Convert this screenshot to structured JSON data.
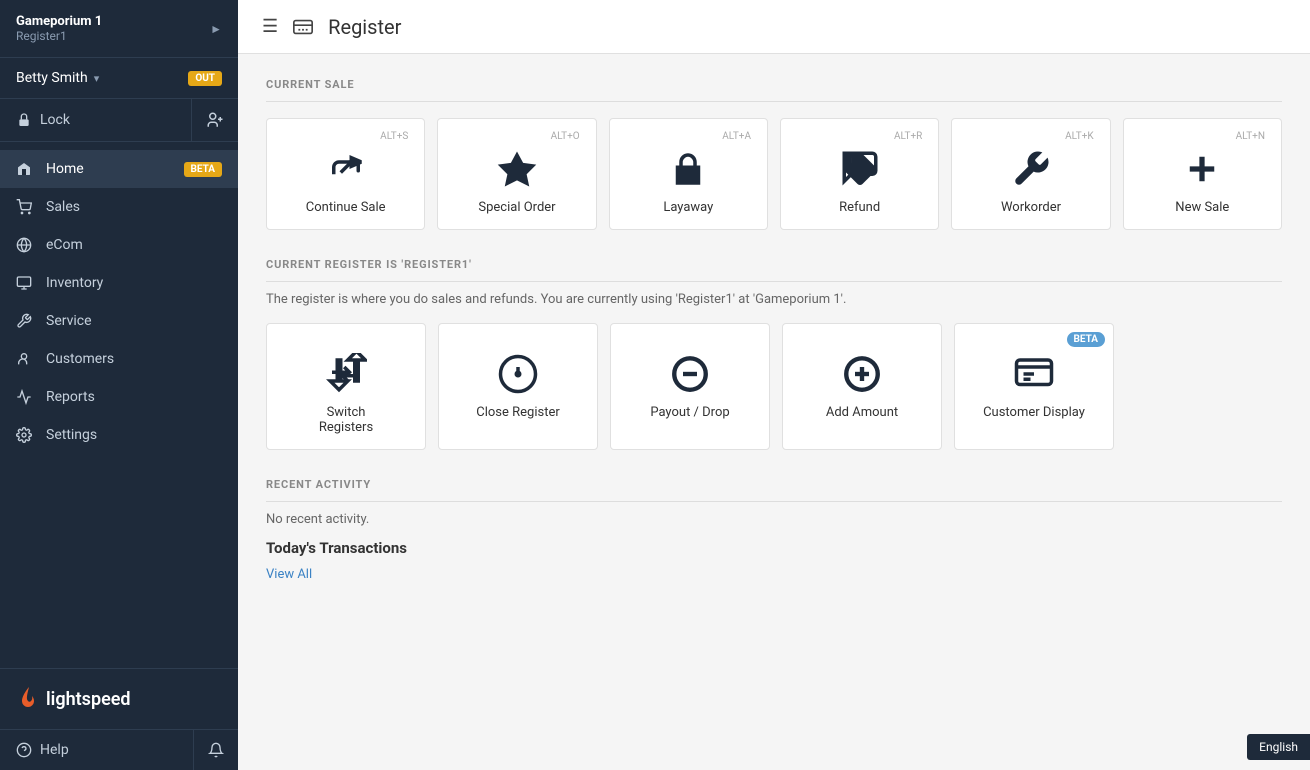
{
  "sidebar": {
    "store_name": "Gameporium 1",
    "register_name": "Register1",
    "user_name": "Betty Smith",
    "user_status_badge": "OUT",
    "lock_label": "Lock",
    "add_user_icon": "➕",
    "nav_items": [
      {
        "id": "home",
        "label": "Home",
        "badge": "BETA"
      },
      {
        "id": "sales",
        "label": "Sales",
        "badge": null
      },
      {
        "id": "ecom",
        "label": "eCom",
        "badge": null
      },
      {
        "id": "inventory",
        "label": "Inventory",
        "badge": null
      },
      {
        "id": "service",
        "label": "Service",
        "badge": null
      },
      {
        "id": "customers",
        "label": "Customers",
        "badge": null
      },
      {
        "id": "reports",
        "label": "Reports",
        "badge": null
      },
      {
        "id": "settings",
        "label": "Settings",
        "badge": null
      }
    ],
    "logo_text": "lightspeed",
    "help_label": "Help"
  },
  "topbar": {
    "title": "Register"
  },
  "current_sale": {
    "section_title": "CURRENT SALE",
    "cards": [
      {
        "id": "continue-sale",
        "shortcut": "ALT+S",
        "label": "Continue Sale"
      },
      {
        "id": "special-order",
        "shortcut": "ALT+O",
        "label": "Special Order"
      },
      {
        "id": "layaway",
        "shortcut": "ALT+A",
        "label": "Layaway"
      },
      {
        "id": "refund",
        "shortcut": "ALT+R",
        "label": "Refund"
      },
      {
        "id": "workorder",
        "shortcut": "ALT+K",
        "label": "Workorder"
      },
      {
        "id": "new-sale",
        "shortcut": "ALT+N",
        "label": "New Sale"
      }
    ]
  },
  "current_register": {
    "section_title": "CURRENT REGISTER IS 'REGISTER1'",
    "info_text": "The register is where you do sales and refunds. You are currently using 'Register1'  at 'Gameporium 1'.",
    "cards": [
      {
        "id": "switch-registers",
        "label": "Switch\nRegisters",
        "beta": false
      },
      {
        "id": "close-register",
        "label": "Close Register",
        "beta": false
      },
      {
        "id": "payout-drop",
        "label": "Payout / Drop",
        "beta": false
      },
      {
        "id": "add-amount",
        "label": "Add Amount",
        "beta": false
      },
      {
        "id": "customer-display",
        "label": "Customer Display",
        "beta": true
      }
    ]
  },
  "recent_activity": {
    "section_title": "RECENT ACTIVITY",
    "no_activity_text": "No recent activity.",
    "transactions_title": "Today's Transactions",
    "view_all_label": "View All"
  },
  "footer": {
    "language": "English"
  }
}
